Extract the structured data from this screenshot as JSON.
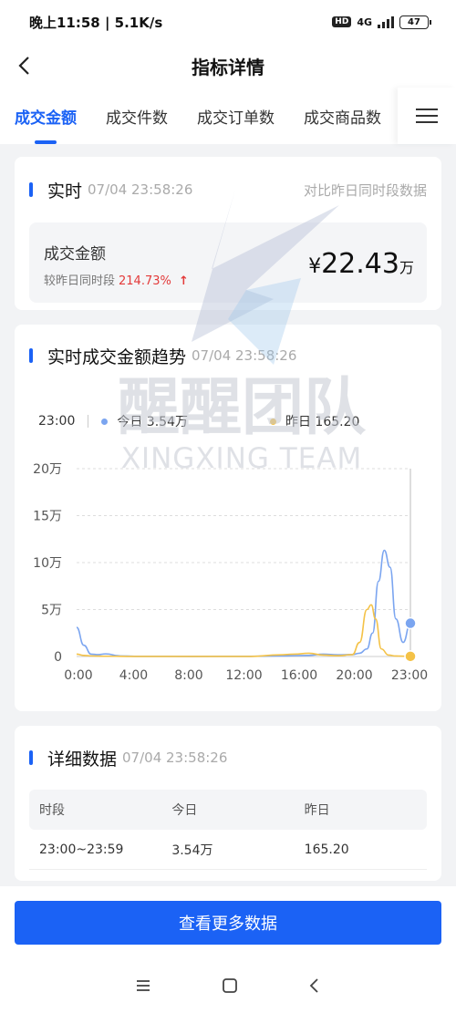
{
  "status_bar": {
    "time": "晚上11:58 | 5.1K/s",
    "hd": "HD",
    "network": "4G",
    "battery": "47"
  },
  "nav": {
    "title": "指标详情"
  },
  "tabs": [
    "成交金额",
    "成交件数",
    "成交订单数",
    "成交商品数"
  ],
  "realtime": {
    "title": "实时",
    "time": "07/04 23:58:26",
    "compare": "对比昨日同时段数据",
    "metric_label": "成交金额",
    "metric_sub": "较昨日同时段",
    "metric_pct": "214.73%",
    "metric_arrow": "↑",
    "currency": "¥",
    "metric_value": "22.43",
    "metric_unit": "万"
  },
  "trend": {
    "title": "实时成交金额趋势",
    "time": "07/04 23:58:26",
    "legend_time": "23:00",
    "today_label": "今日 3.54万",
    "yesterday_label": "昨日 165.20"
  },
  "chart_data": {
    "type": "line",
    "y_ticks": [
      "20万",
      "15万",
      "10万",
      "5万",
      "0"
    ],
    "x_ticks": [
      "0:00",
      "4:00",
      "8:00",
      "12:00",
      "16:00",
      "20:00",
      "23:00"
    ],
    "ylim": [
      0,
      200000
    ],
    "xlim": [
      0,
      23
    ],
    "series": [
      {
        "name": "今日",
        "color": "#7ba5f0",
        "points": [
          [
            0,
            31000
          ],
          [
            0.5,
            12000
          ],
          [
            1,
            2500
          ],
          [
            1.5,
            2000
          ],
          [
            2,
            2800
          ],
          [
            3,
            600
          ],
          [
            4,
            200
          ],
          [
            8,
            100
          ],
          [
            12,
            200
          ],
          [
            14,
            600
          ],
          [
            16,
            1200
          ],
          [
            17,
            2500
          ],
          [
            18,
            1800
          ],
          [
            19,
            2000
          ],
          [
            19.5,
            3500
          ],
          [
            20,
            8000
          ],
          [
            20.4,
            25000
          ],
          [
            20.8,
            80000
          ],
          [
            21.2,
            113000
          ],
          [
            21.6,
            95000
          ],
          [
            22,
            40000
          ],
          [
            22.5,
            15000
          ],
          [
            23,
            35400
          ]
        ]
      },
      {
        "name": "昨日",
        "color": "#f4c247",
        "points": [
          [
            0,
            2500
          ],
          [
            0.5,
            1200
          ],
          [
            1,
            600
          ],
          [
            2,
            300
          ],
          [
            4,
            100
          ],
          [
            8,
            50
          ],
          [
            12,
            100
          ],
          [
            14,
            1800
          ],
          [
            15,
            2500
          ],
          [
            16,
            3500
          ],
          [
            17,
            1500
          ],
          [
            18,
            800
          ],
          [
            19,
            2000
          ],
          [
            19.5,
            15000
          ],
          [
            20,
            50000
          ],
          [
            20.3,
            55000
          ],
          [
            20.6,
            40000
          ],
          [
            21,
            8000
          ],
          [
            21.5,
            1500
          ],
          [
            22,
            500
          ],
          [
            23,
            165.2
          ]
        ]
      }
    ]
  },
  "detail": {
    "title": "详细数据",
    "time": "07/04 23:58:26",
    "columns": [
      "时段",
      "今日",
      "昨日"
    ],
    "rows": [
      [
        "23:00~23:59",
        "3.54万",
        "165.20"
      ]
    ]
  },
  "buttons": {
    "more": "查看更多数据"
  },
  "colors": {
    "accent": "#1b62f5",
    "up": "#e33a3a",
    "today": "#7ba5f0",
    "yesterday": "#f4c247"
  },
  "watermark": {
    "cn": "醒醒团队",
    "en": "XINGXING TEAM"
  }
}
